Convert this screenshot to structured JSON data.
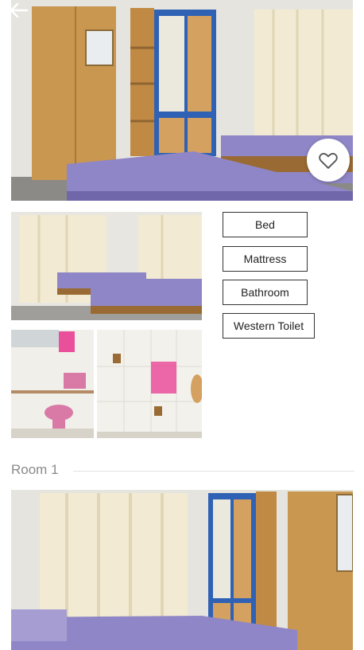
{
  "amenities": [
    {
      "label": "Bed"
    },
    {
      "label": "Mattress"
    },
    {
      "label": "Bathroom"
    },
    {
      "label": "Western Toilet"
    }
  ],
  "section": {
    "title": "Room 1"
  },
  "colors": {
    "wood": "#c9974f",
    "wardrobe_blue": "#2f62b4",
    "bedsheet": "#8e86c6",
    "curtain": "#f2ead2",
    "wall": "#ebebe7"
  },
  "icons": {
    "back": "arrow-left-icon",
    "favorite": "heart-outline-icon"
  }
}
